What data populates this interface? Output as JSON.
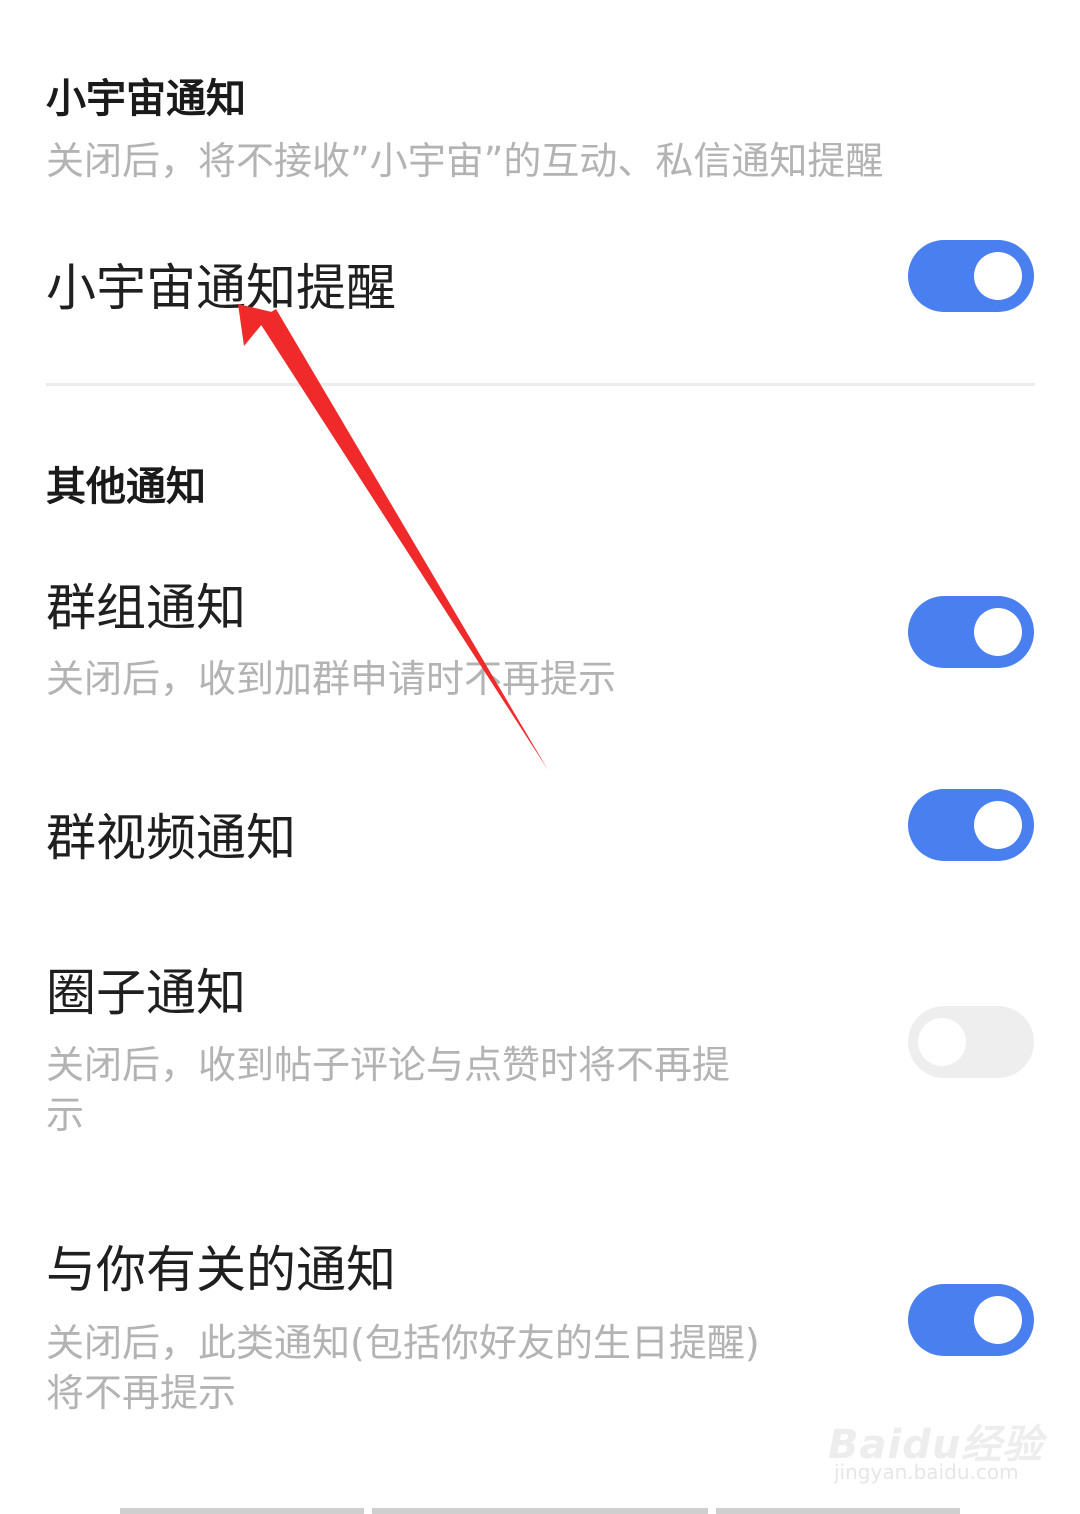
{
  "xiaoyuzhou": {
    "section_title": "小宇宙通知",
    "section_desc": "关闭后，将不接收”小宇宙”的互动、私信通知提醒",
    "row_label": "小宇宙通知提醒",
    "toggle_on": true
  },
  "other": {
    "section_title": "其他通知",
    "items": [
      {
        "label": "群组通知",
        "desc": "关闭后，收到加群申请时不再提示",
        "toggle_on": true
      },
      {
        "label": "群视频通知",
        "desc": "",
        "toggle_on": true
      },
      {
        "label": "圈子通知",
        "desc": "关闭后，收到帖子评论与点赞时将不再提示",
        "toggle_on": false
      },
      {
        "label": "与你有关的通知",
        "desc": "关闭后，此类通知(包括你好友的生日提醒)将不再提示",
        "toggle_on": true
      }
    ]
  },
  "watermark": {
    "logo": "Baidu经验",
    "url": "jingyan.baidu.com"
  },
  "colors": {
    "toggle_on": "#4a7ff0",
    "toggle_off": "#eeeeee",
    "annotation_arrow": "#f02a2a",
    "secondary_text": "#b3b3b3"
  }
}
